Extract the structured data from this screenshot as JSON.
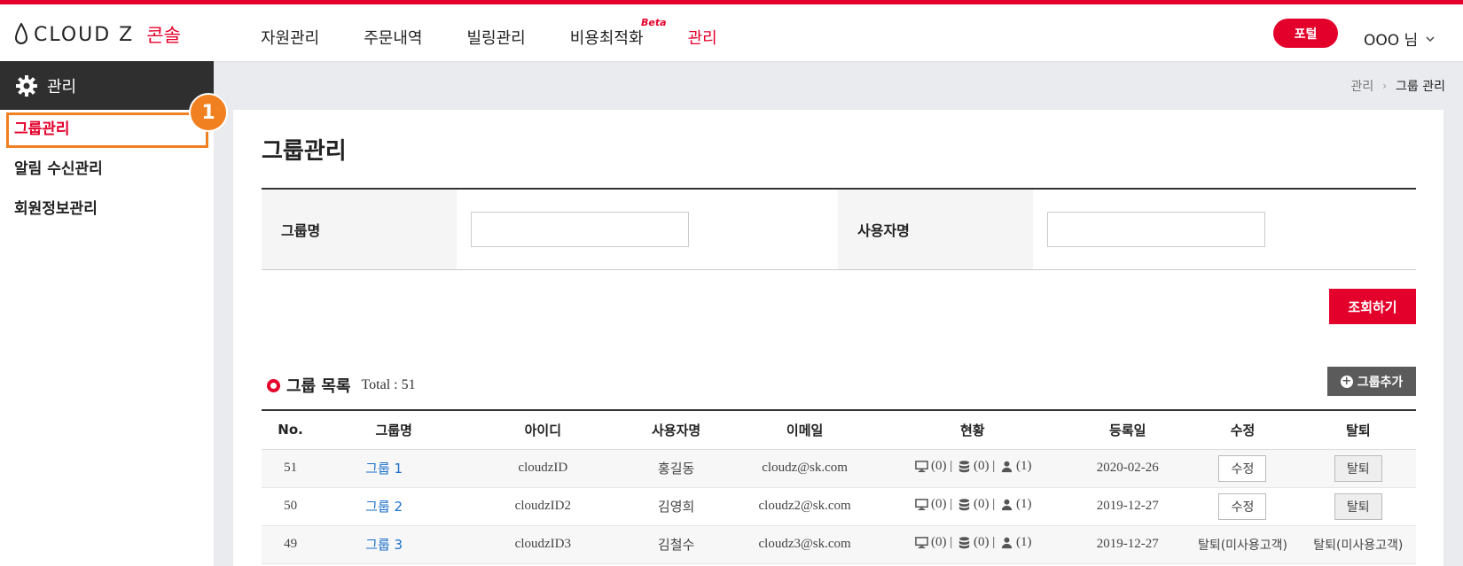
{
  "header": {
    "logo_text": "CLOUD Z",
    "logo_sub": "콘솔",
    "nav": [
      {
        "label": "자원관리"
      },
      {
        "label": "주문내역"
      },
      {
        "label": "빌링관리"
      },
      {
        "label": "비용최적화",
        "badge": "Beta"
      },
      {
        "label": "관리"
      }
    ],
    "portal_label": "포털",
    "user_label": "OOO 님"
  },
  "sidebar": {
    "title": "관리",
    "items": [
      {
        "label": "그룹관리"
      },
      {
        "label": "알림 수신관리"
      },
      {
        "label": "회원정보관리"
      }
    ],
    "annotation_number": "1"
  },
  "breadcrumb": [
    "관리",
    "그룹 관리"
  ],
  "page_title": "그룹관리",
  "search": {
    "group_label": "그룹명",
    "group_value": "",
    "user_label": "사용자명",
    "user_value": "",
    "submit_label": "조회하기"
  },
  "list": {
    "title": "그룹 목록",
    "total_label": "Total : 51",
    "add_label": "그룹추가",
    "columns": [
      "No.",
      "그룹명",
      "아이디",
      "사용자명",
      "이메일",
      "현황",
      "등록일",
      "수정",
      "탈퇴"
    ],
    "rows": [
      {
        "no": "51",
        "group": "그룹 1",
        "id": "cloudzID",
        "user": "홍길동",
        "email": "cloudz@sk.com",
        "monitors": "(0)",
        "dbs": "(0)",
        "users": "(1)",
        "date": "2020-02-26",
        "edit": "수정",
        "edit_button": true,
        "withdraw": "탈퇴",
        "withdraw_button": true
      },
      {
        "no": "50",
        "group": "그룹 2",
        "id": "cloudzID2",
        "user": "김영희",
        "email": "cloudz2@sk.com",
        "monitors": "(0)",
        "dbs": "(0)",
        "users": "(1)",
        "date": "2019-12-27",
        "edit": "수정",
        "edit_button": true,
        "withdraw": "탈퇴",
        "withdraw_button": true
      },
      {
        "no": "49",
        "group": "그룹 3",
        "id": "cloudzID3",
        "user": "김철수",
        "email": "cloudz3@sk.com",
        "monitors": "(0)",
        "dbs": "(0)",
        "users": "(1)",
        "date": "2019-12-27",
        "edit": "탈퇴(미사용고객)",
        "edit_button": false,
        "withdraw": "탈퇴(미사용고객)",
        "withdraw_button": false
      }
    ]
  },
  "colors": {
    "accent": "#e3002b",
    "annotation": "#f08020",
    "link": "#1a6fc9",
    "sidebar_head": "#2f2f2f"
  }
}
